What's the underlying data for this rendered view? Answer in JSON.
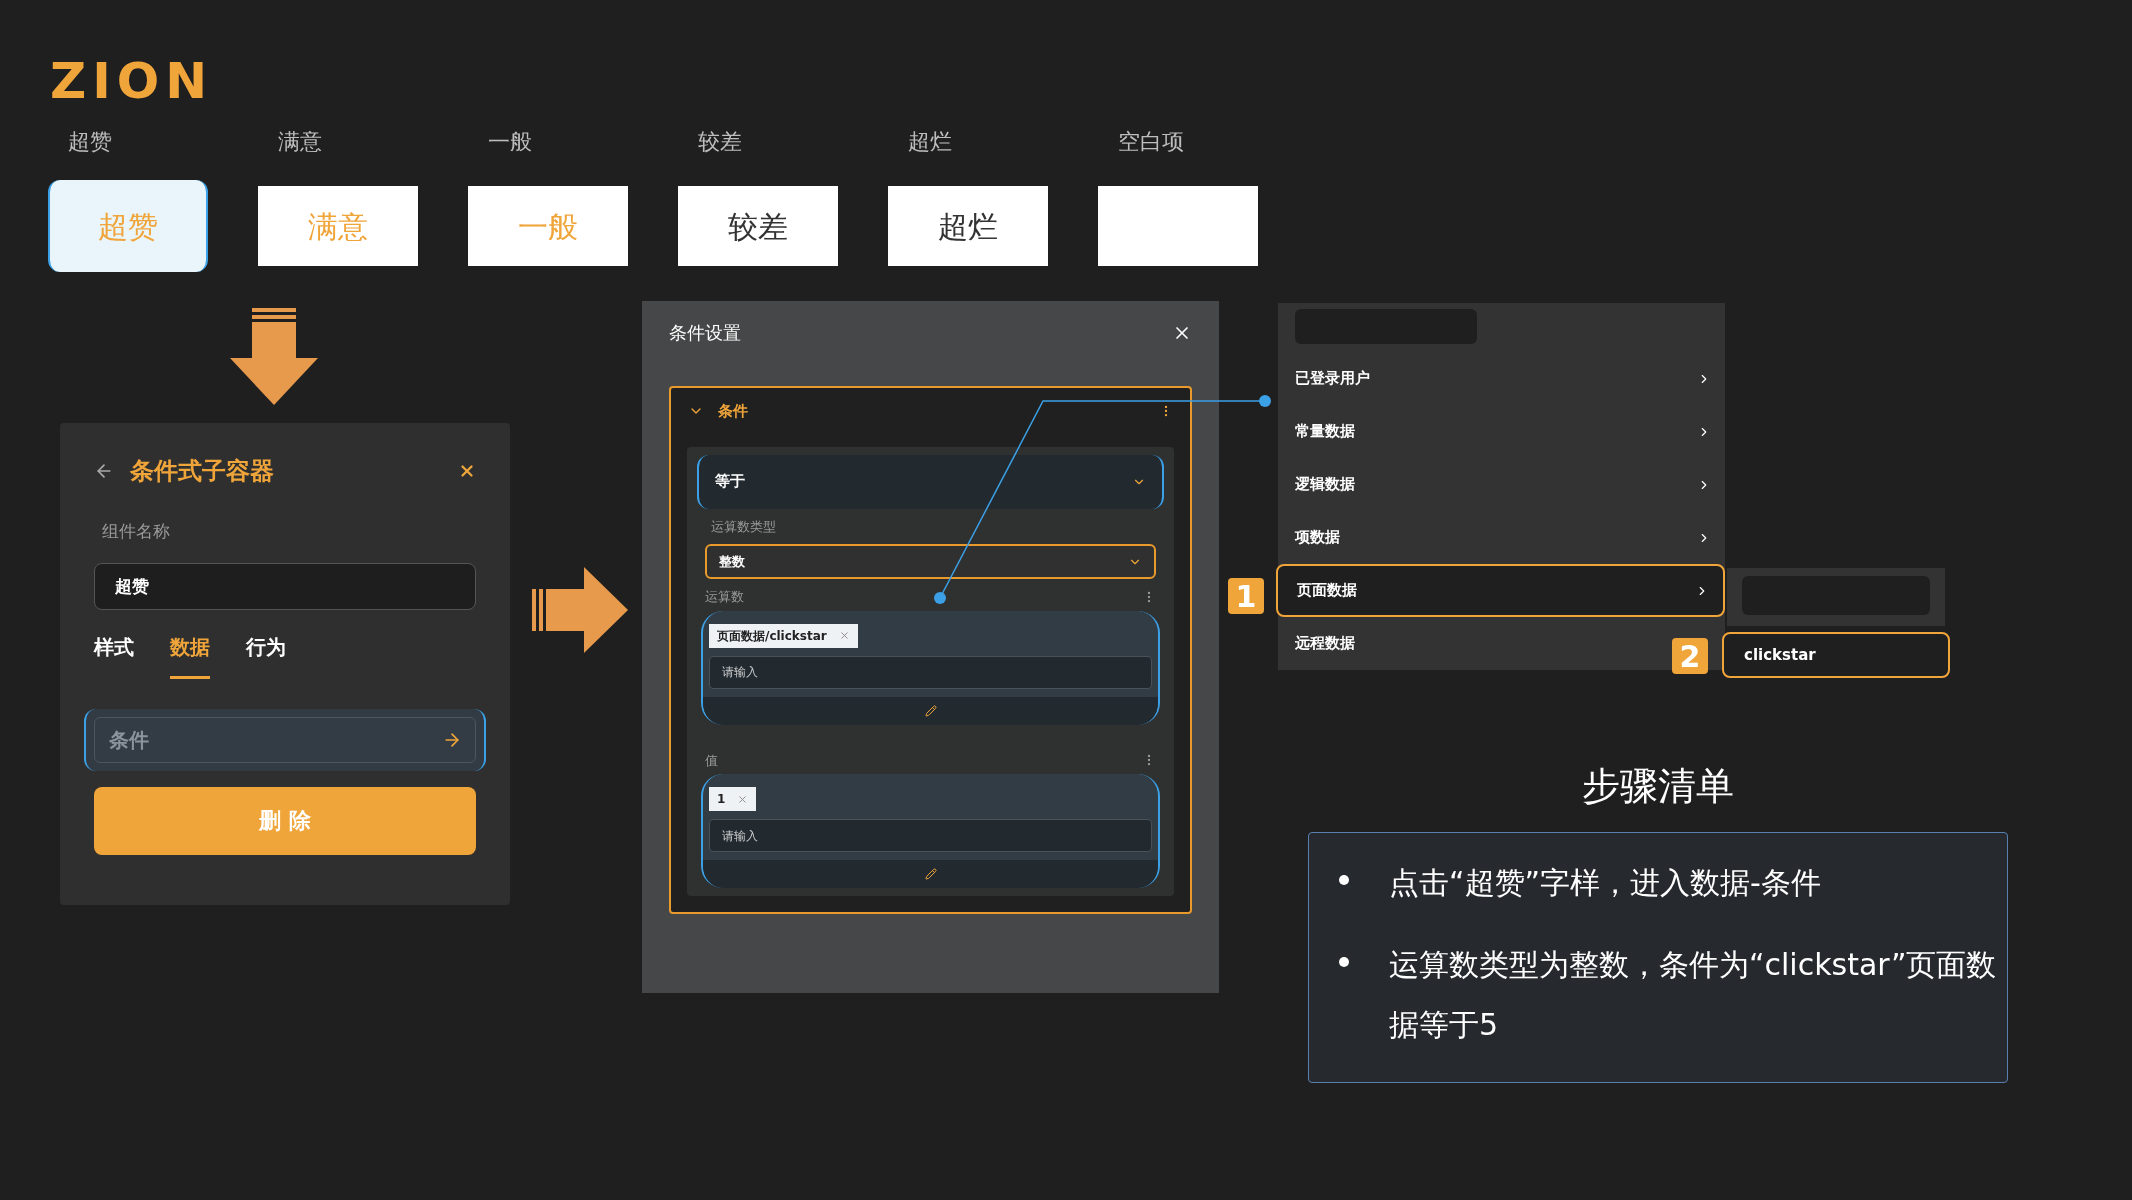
{
  "logo": "ZION",
  "ratings": [
    {
      "label": "超赞",
      "text": "超赞",
      "selected": true,
      "color": "#f0a53a"
    },
    {
      "label": "满意",
      "text": "满意",
      "selected": false,
      "color": "#f0a53a"
    },
    {
      "label": "一般",
      "text": "一般",
      "selected": false,
      "color": "#f0a53a"
    },
    {
      "label": "较差",
      "text": "较差",
      "selected": false,
      "color": "#333333"
    },
    {
      "label": "超烂",
      "text": "超烂",
      "selected": false,
      "color": "#333333"
    },
    {
      "label": "空白项",
      "selected": false
    }
  ],
  "property_panel": {
    "title": "条件式子容器",
    "name_label": "组件名称",
    "name_value": "超赞",
    "tabs": [
      {
        "label": "样式",
        "selected": false
      },
      {
        "label": "数据",
        "selected": true
      },
      {
        "label": "行为",
        "selected": false
      }
    ],
    "condition_field": {
      "placeholder": "条件"
    },
    "delete_button": "删 除"
  },
  "dialog": {
    "title": "条件设置",
    "section": {
      "title": "条件",
      "expanded": true
    },
    "operator": "等于",
    "operand_type_label": "运算数类型",
    "operand_type": "整数",
    "operand": {
      "label": "运算数",
      "tag": "页面数据/clickstar",
      "placeholder": "请输入"
    },
    "value": {
      "label": "值",
      "tag": "1",
      "placeholder": "请输入"
    }
  },
  "menu": {
    "items": [
      {
        "label": "已登录用户",
        "selected": false
      },
      {
        "label": "常量数据",
        "selected": false
      },
      {
        "label": "逻辑数据",
        "selected": false
      },
      {
        "label": "项数据",
        "selected": false
      },
      {
        "label": "页面数据",
        "selected": true
      },
      {
        "label": "远程数据",
        "selected": false
      }
    ],
    "submenu_item": "clickstar"
  },
  "badges": [
    "1",
    "2"
  ],
  "steps": {
    "title": "步骤清单",
    "items": [
      "点击“超赞”字样，进入数据-条件",
      "运算数类型为整数，条件为“clickstar”页面数据等于5"
    ]
  }
}
